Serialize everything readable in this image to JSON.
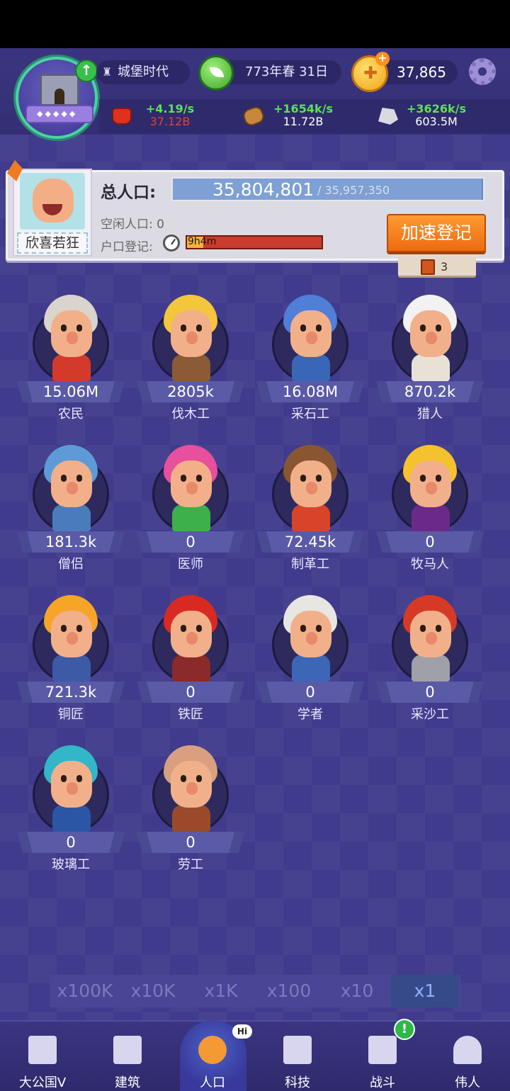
{
  "header": {
    "era_label": "城堡时代",
    "date_label": "773年春 31日",
    "gold_amount": "37,865"
  },
  "resources": [
    {
      "icon": "apple-icon",
      "rate": "+4.19/s",
      "amount": "37.12B",
      "amount_color": "#e2403a"
    },
    {
      "icon": "wood-icon",
      "rate": "+1654k/s",
      "amount": "11.72B",
      "amount_color": "#ffffff"
    },
    {
      "icon": "stone-icon",
      "rate": "+3626k/s",
      "amount": "603.5M",
      "amount_color": "#ffffff"
    }
  ],
  "population": {
    "leader_name": "欣喜若狂",
    "total_label": "总人口:",
    "total_value": "35,804,801",
    "total_cap": "/ 35,957,350",
    "fill_fraction": 0.9958,
    "idle_label": "空闲人口: 0",
    "register_label": "户口登记:",
    "register_timer": "9h4m",
    "register_fill_fraction": 0.12,
    "speed_button": "加速登记",
    "book_count": "3"
  },
  "workers": [
    {
      "name": "农民",
      "count": "15.06M"
    },
    {
      "name": "伐木工",
      "count": "2805k"
    },
    {
      "name": "采石工",
      "count": "16.08M"
    },
    {
      "name": "猎人",
      "count": "870.2k"
    },
    {
      "name": "僧侣",
      "count": "181.3k"
    },
    {
      "name": "医师",
      "count": "0"
    },
    {
      "name": "制革工",
      "count": "72.45k"
    },
    {
      "name": "牧马人",
      "count": "0"
    },
    {
      "name": "铜匠",
      "count": "721.3k"
    },
    {
      "name": "铁匠",
      "count": "0"
    },
    {
      "name": "学者",
      "count": "0"
    },
    {
      "name": "采沙工",
      "count": "0"
    },
    {
      "name": "玻璃工",
      "count": "0"
    },
    {
      "name": "劳工",
      "count": "0"
    }
  ],
  "multipliers": [
    "x100K",
    "x10K",
    "x1K",
    "x100",
    "x10",
    "x1"
  ],
  "active_multiplier": "x1",
  "nav": {
    "items": [
      "大公国V",
      "建筑",
      "人口",
      "科技",
      "战斗",
      "伟人"
    ],
    "active": "人口",
    "hi_badge": "Hi",
    "alert_badge": "!"
  },
  "colors": {
    "accent_orange": "#ef6f14",
    "rate_green": "#5ce15a",
    "bg_purple": "#403b8c"
  }
}
